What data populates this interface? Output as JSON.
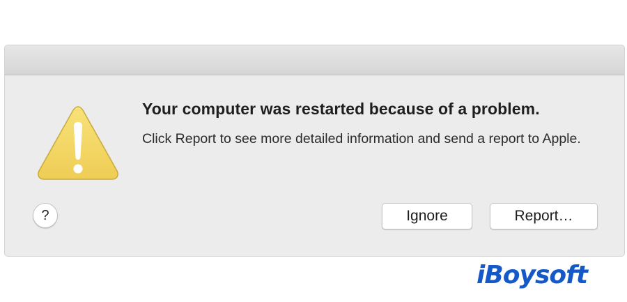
{
  "dialog": {
    "title": "Your computer was restarted because of a problem.",
    "message": "Click Report to see more detailed information and send a report to Apple.",
    "help_label": "?",
    "ignore_label": "Ignore",
    "report_label": "Report…",
    "icon": "warning-triangle-icon"
  },
  "watermark": {
    "text": "iBoysoft"
  },
  "colors": {
    "dialog_bg": "#ececec",
    "warning_yellow": "#f3d762",
    "brand_blue": "#1559c9"
  }
}
